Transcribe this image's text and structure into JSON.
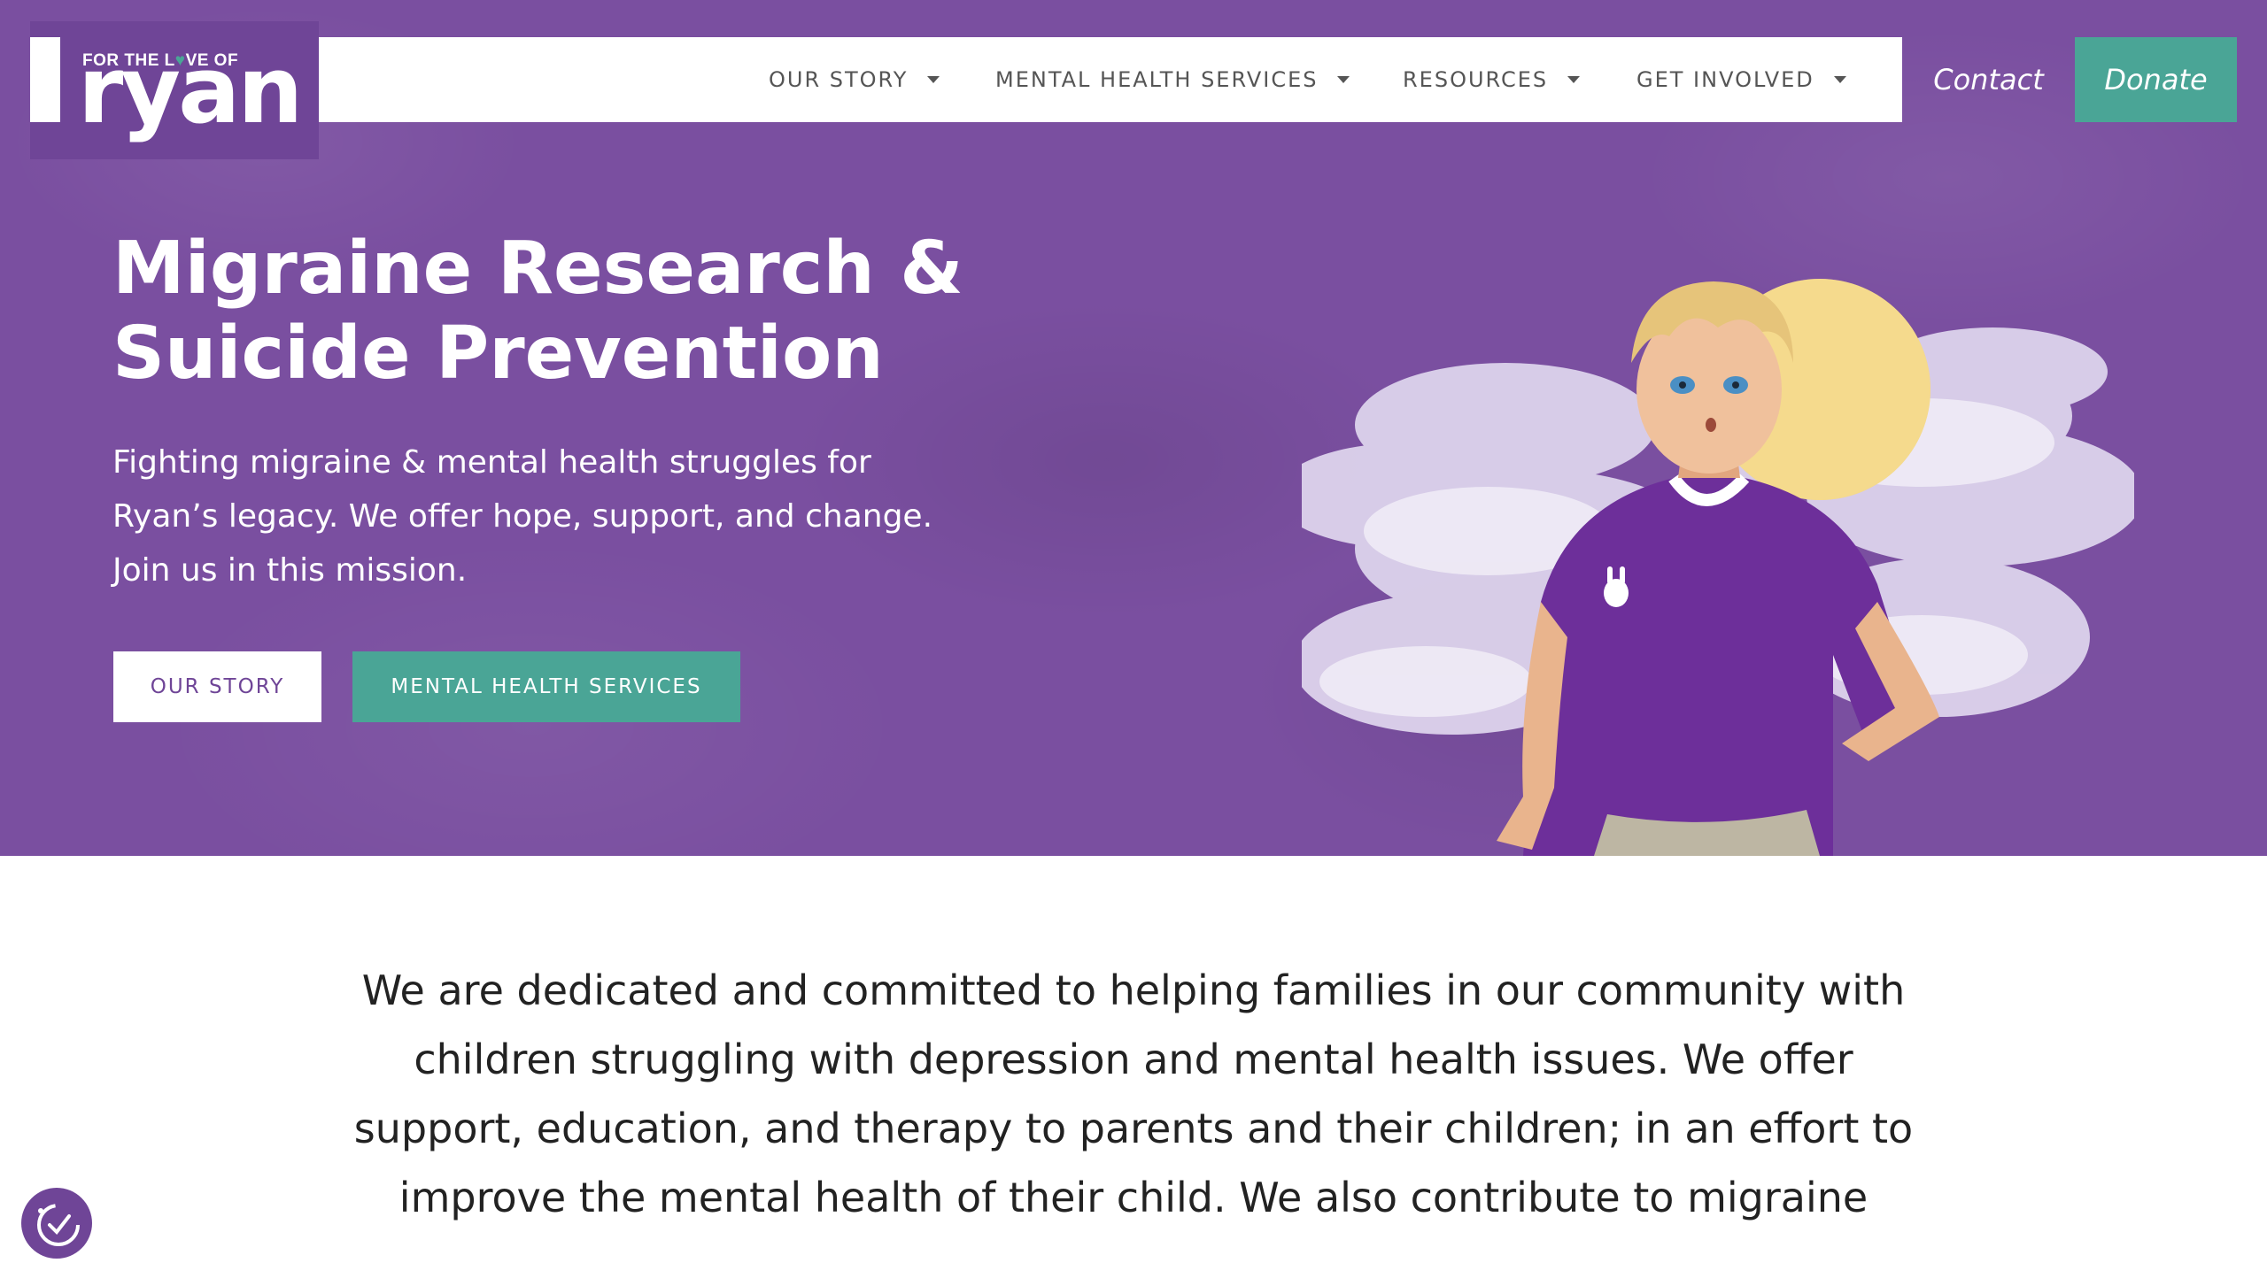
{
  "brand": {
    "logo_small": "FOR THE L",
    "logo_small_heart": "♥",
    "logo_small_end": "VE OF",
    "logo_big": "ryan"
  },
  "nav": {
    "items": [
      {
        "label": "OUR STORY"
      },
      {
        "label": "MENTAL HEALTH SERVICES"
      },
      {
        "label": "RESOURCES"
      },
      {
        "label": "GET INVOLVED"
      }
    ],
    "contact": "Contact",
    "donate": "Donate"
  },
  "hero": {
    "title_line1": "Migraine Research &",
    "title_line2": "Suicide Prevention",
    "subtitle": "Fighting migraine & mental health struggles for Ryan’s legacy. We offer hope, support, and change. Join us in this mission.",
    "btn_story": "OUR STORY",
    "btn_services": "MENTAL HEALTH SERVICES"
  },
  "mission": {
    "text": "We are dedicated and committed to helping families in our community with children struggling with depression and mental health issues. We offer support, education, and therapy to parents and their children; in an effort to improve the mental health of their child. We also contribute to migraine"
  },
  "colors": {
    "hero_bg": "#7a4fa0",
    "logo_bg": "#6f4597",
    "accent_teal": "#4aa596",
    "nav_text": "#555555"
  },
  "icons": {
    "accessibility": "accessibility-icon",
    "caret": "chevron-down-icon"
  }
}
